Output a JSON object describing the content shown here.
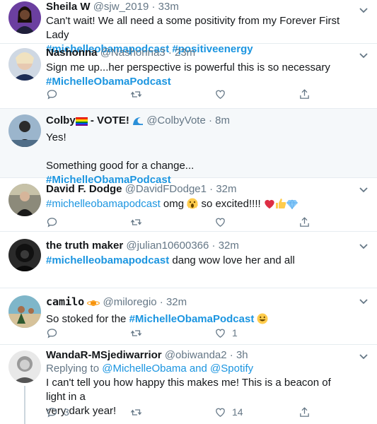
{
  "tweets": [
    {
      "name": "Sheila W",
      "handle": "@sjw_2019",
      "sep": " · ",
      "time": "33m",
      "line1": "Can't wait! We all need a some positivity from my Forever First Lady",
      "tag1": "#michelleobamapodcast",
      "tag2": "#positiveenergy"
    },
    {
      "name": "Nashonna",
      "handle": "@Nashonna3",
      "sep": " · ",
      "time": "23m",
      "line1": "Sign me up...her perspective is powerful this is so necessary",
      "tag1": "#MichelleObamaPodcast"
    },
    {
      "name": "Colby",
      "name_suffix": " - VOTE!",
      "handle": "@ColbyVote",
      "sep": " · ",
      "time": "8m",
      "line1": "Yes!",
      "line2": "Something good for a change...",
      "tag1": "#MichelleObamaPodcast"
    },
    {
      "name": "David F. Dodge",
      "handle": "@DavidFDodge1",
      "sep": " · ",
      "time": "32m",
      "tag1": "#michelleobamapodcast",
      "text_a": " omg ",
      "text_b": " so excited!!!! "
    },
    {
      "name": "the truth maker",
      "handle": "@julian10600366",
      "sep": " · ",
      "time": "32m",
      "tag1": "#michelleobamapodcast",
      "text_a": " dang wow love her and all"
    },
    {
      "name": "camilo",
      "handle": "@miloregio",
      "sep": " · ",
      "time": "32m",
      "text_a": "So stoked for the ",
      "tag1": "#MichelleObamaPodcast",
      "like_count": "1"
    },
    {
      "name": "WandaR-MSjediwarrior",
      "handle": "@obiwanda2",
      "sep": " · ",
      "time": "3h",
      "reply_prefix": "Replying to ",
      "reply_m1": "@MichelleObama",
      "reply_and": " and ",
      "reply_m2": "@Spotify",
      "line1": "I can't tell you how happy this makes me!  This is a beacon of light in a",
      "line2": "very dark year!",
      "reply_count": "3",
      "like_count": "14"
    }
  ],
  "icons": {
    "reply": "reply-icon",
    "retweet": "retweet-icon",
    "like": "heart-icon",
    "share": "share-icon",
    "menu": "chevron-down-icon"
  },
  "colors": {
    "link": "#1b95e0",
    "muted": "#657786",
    "highlight_bg": "#f5f8fa",
    "divider": "#e6ecf0"
  }
}
